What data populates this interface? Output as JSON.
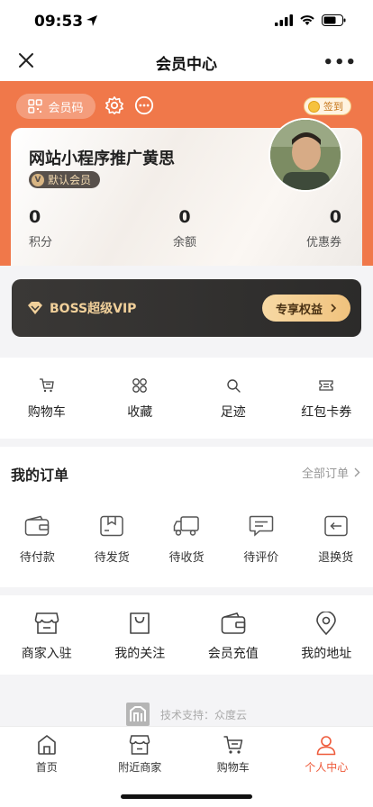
{
  "status_bar": {
    "time": "09:53"
  },
  "navbar": {
    "title": "会员中心"
  },
  "header": {
    "qr_label": "会员码",
    "signin_label": "签到"
  },
  "member": {
    "name": "网站小程序推广黄思",
    "level": "默认会员",
    "level_badge": "V",
    "stats": [
      {
        "value": "0",
        "label": "积分"
      },
      {
        "value": "0",
        "label": "余额"
      },
      {
        "value": "0",
        "label": "优惠券"
      }
    ]
  },
  "vip": {
    "title": "BOSS超级VIP",
    "button": "专享权益"
  },
  "quick_links": [
    {
      "label": "购物车",
      "icon": "cart-icon"
    },
    {
      "label": "收藏",
      "icon": "collection-icon"
    },
    {
      "label": "足迹",
      "icon": "footprint-search-icon"
    },
    {
      "label": "红包卡券",
      "icon": "coupon-icon"
    }
  ],
  "orders": {
    "title": "我的订单",
    "all_label": "全部订单",
    "items": [
      {
        "label": "待付款",
        "icon": "wallet-icon"
      },
      {
        "label": "待发货",
        "icon": "package-icon"
      },
      {
        "label": "待收货",
        "icon": "truck-icon"
      },
      {
        "label": "待评价",
        "icon": "comment-icon"
      },
      {
        "label": "退换货",
        "icon": "return-icon"
      }
    ]
  },
  "services": [
    {
      "label": "商家入驻",
      "icon": "shop-icon"
    },
    {
      "label": "我的关注",
      "icon": "bag-icon"
    },
    {
      "label": "会员充值",
      "icon": "wallet-icon"
    },
    {
      "label": "我的地址",
      "icon": "location-icon"
    }
  ],
  "powered_by": "技术支持：众度云",
  "tabbar": [
    {
      "label": "首页",
      "icon": "home-icon"
    },
    {
      "label": "附近商家",
      "icon": "store-icon"
    },
    {
      "label": "购物车",
      "icon": "cart-icon"
    },
    {
      "label": "个人中心",
      "icon": "person-icon",
      "active": true
    }
  ],
  "colors": {
    "accent": "#f0784a",
    "tab_active": "#ee5a3a",
    "vip_gold": "#f1d09a"
  }
}
